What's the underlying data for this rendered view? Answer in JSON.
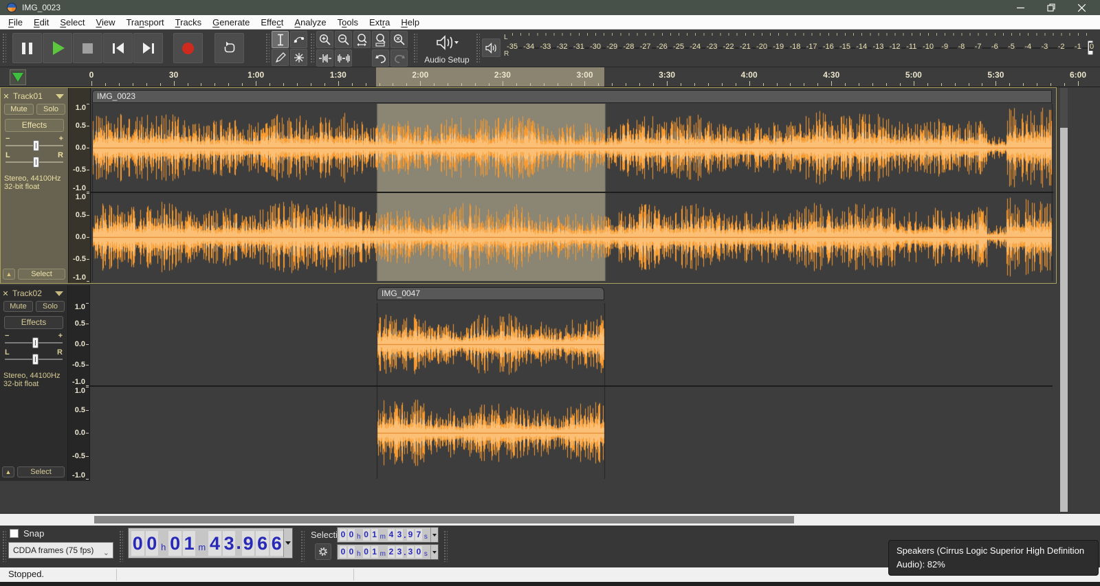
{
  "titlebar": {
    "title": "IMG_0023"
  },
  "menu": {
    "items": [
      {
        "label": "File",
        "u": 0
      },
      {
        "label": "Edit",
        "u": 0
      },
      {
        "label": "Select",
        "u": 0
      },
      {
        "label": "View",
        "u": 0
      },
      {
        "label": "Transport",
        "u": 3
      },
      {
        "label": "Tracks",
        "u": 0
      },
      {
        "label": "Generate",
        "u": 0
      },
      {
        "label": "Effect",
        "u": 4
      },
      {
        "label": "Analyze",
        "u": 0
      },
      {
        "label": "Tools",
        "u": 1
      },
      {
        "label": "Extra",
        "u": 3
      },
      {
        "label": "Help",
        "u": 0
      }
    ]
  },
  "transport": {
    "buttons": [
      "pause",
      "play",
      "stop",
      "skip-to-start",
      "skip-to-end",
      "record",
      "loop"
    ]
  },
  "tools": {
    "buttons": [
      "selection-tool",
      "envelope-tool",
      "draw-tool",
      "multi-tool"
    ],
    "active": "selection-tool"
  },
  "edit_toolbar": {
    "buttons": [
      "zoom-in",
      "zoom-out",
      "fit-selection",
      "fit-project",
      "zoom-toggle",
      "trim-audio",
      "silence-audio",
      "undo",
      "redo"
    ]
  },
  "audio_setup": {
    "label": "Audio Setup",
    "icon": "speaker-icon"
  },
  "meter": {
    "channel_labels": [
      "L",
      "R"
    ],
    "ticks": [
      "-35",
      "-34",
      "-33",
      "-32",
      "-31",
      "-30",
      "-29",
      "-28",
      "-27",
      "-26",
      "-25",
      "-24",
      "-23",
      "-22",
      "-21",
      "-20",
      "-19",
      "-18",
      "-17",
      "-16",
      "-15",
      "-14",
      "-13",
      "-12",
      "-11",
      "-10",
      "-9",
      "-8",
      "-7",
      "-6",
      "-5",
      "-4",
      "-3",
      "-2",
      "-1",
      "0"
    ]
  },
  "ruler": {
    "labels": [
      "0",
      "30",
      "1:00",
      "1:30",
      "2:00",
      "2:30",
      "3:00",
      "3:30",
      "4:00",
      "4:30",
      "5:00",
      "5:30",
      "6:00"
    ],
    "interval_s": 30,
    "selection_start_s": 103.97,
    "selection_end_s": 187.27
  },
  "tracks": [
    {
      "name": "Track01",
      "selected": true,
      "mute": "Mute",
      "solo": "Solo",
      "effects": "Effects",
      "select_label": "Select",
      "gain_min": "−",
      "gain_max": "+",
      "pan_left": "L",
      "pan_right": "R",
      "info_line1": "Stereo, 44100Hz",
      "info_line2": "32-bit float",
      "scale": [
        "1.0",
        "0.5",
        "0.0",
        "-0.5",
        "-1.0"
      ],
      "clip": {
        "title": "IMG_0023"
      },
      "has_selection": true
    },
    {
      "name": "Track02",
      "selected": false,
      "mute": "Mute",
      "solo": "Solo",
      "effects": "Effects",
      "select_label": "Select",
      "gain_min": "−",
      "gain_max": "+",
      "pan_left": "L",
      "pan_right": "R",
      "info_line1": "Stereo, 44100Hz",
      "info_line2": "32-bit float",
      "scale": [
        "1.0",
        "0.5",
        "0.0",
        "-0.5",
        "-1.0"
      ],
      "clip": {
        "title": "IMG_0047"
      },
      "has_selection": false
    }
  ],
  "waveform": {
    "peak_color": "#f79b31",
    "rms_color": "#fbc076",
    "background": "#3d3d3d",
    "selection_color": "#8b8573",
    "center_color": "#e07d1f"
  },
  "snap": {
    "label": "Snap",
    "checked": false,
    "format": "CDDA frames (75 fps)"
  },
  "time_display": {
    "h": "00",
    "m": "01",
    "s": "43.966",
    "unit_h": "h",
    "unit_m": "m",
    "unit_s": "s"
  },
  "selection_toolbar": {
    "label": "Selection",
    "fields": [
      {
        "h": "00",
        "m": "01",
        "s": "43.97"
      },
      {
        "h": "00",
        "m": "01",
        "s": "23.30"
      }
    ]
  },
  "status": {
    "text": "Stopped."
  },
  "tooltip": {
    "text": "Speakers (Cirrus Logic Superior High Definition Audio): 82%"
  },
  "colors": {
    "play_green": "#5cc63e",
    "record_red": "#ce2a1d",
    "focus_border": "#aca45e",
    "panel_selected": "#676350"
  }
}
